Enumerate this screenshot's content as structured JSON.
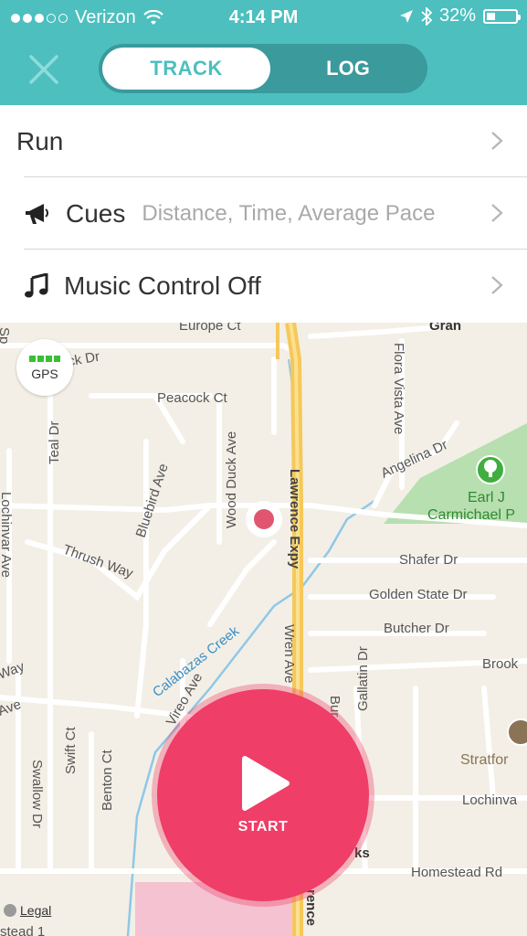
{
  "status_bar": {
    "carrier": "Verizon",
    "time": "4:14 PM",
    "battery": "32%",
    "signal_bars": 3,
    "battery_level": 0.32
  },
  "header": {
    "close_icon": "close-icon",
    "tabs": [
      {
        "label": "TRACK",
        "active": true
      },
      {
        "label": "LOG",
        "active": false
      }
    ]
  },
  "menu": {
    "activity": "Run",
    "cues_label": "Cues",
    "cues_value": "Distance, Time, Average Pace",
    "music_label": "Music Control Off"
  },
  "map": {
    "gps_label": "GPS",
    "legal": "Legal",
    "streets": [
      "Europe Ct",
      "ick Dr",
      "Peacock Ct",
      "Teal Dr",
      "Bluebird Ave",
      "Wood Duck Ave",
      "Lawrence Expy",
      "Flora Vista Ave",
      "Angelina Dr",
      "Earl J",
      "Carmichael P",
      "Lochinvar Ave",
      "Thrush Way",
      "Shafer Dr",
      "Golden State Dr",
      "Butcher Dr",
      "Calabazas Creek",
      "Vireo Ave",
      "Wren Ave",
      "Brook",
      "Gallatin Dr",
      "Bur",
      "Way",
      "Ave",
      "Swallow Dr",
      "Swift Ct",
      "Benton Ct",
      "Stratfor",
      "Lochinva",
      "Homestead Rd",
      "ks",
      "Gran",
      "Sp",
      "rence",
      "stead 1"
    ],
    "colors": {
      "road": "#ffffff",
      "highway": "#f5c85a",
      "creek": "#8ec8e8",
      "park": "#b7dfb0"
    }
  },
  "start_button": {
    "label": "START"
  },
  "colors": {
    "accent": "#4dbfbf",
    "start": "#ef3e67",
    "gps": "#39c032",
    "location": "#e0566f"
  }
}
